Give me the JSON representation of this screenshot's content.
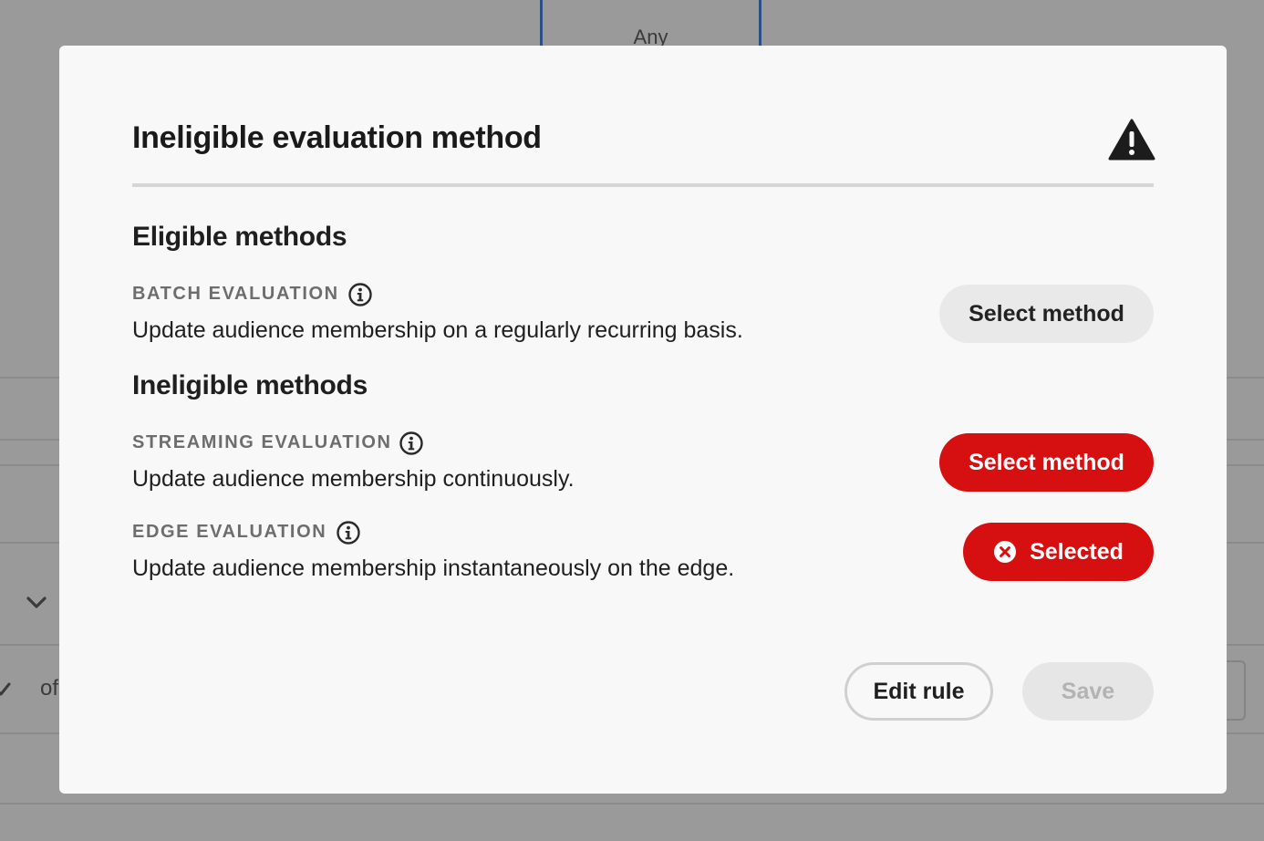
{
  "background": {
    "tab_label": "Any",
    "partial_text": "of"
  },
  "dialog": {
    "title": "Ineligible evaluation method",
    "eligible": {
      "heading": "Eligible methods",
      "methods": [
        {
          "label": "BATCH EVALUATION",
          "description": "Update audience membership on a regularly recurring basis.",
          "button_label": "Select method"
        }
      ]
    },
    "ineligible": {
      "heading": "Ineligible methods",
      "methods": [
        {
          "label": "STREAMING EVALUATION",
          "description": "Update audience membership continuously.",
          "button_label": "Select method"
        },
        {
          "label": "EDGE EVALUATION",
          "description": "Update audience membership instantaneously on the edge.",
          "button_label": "Selected"
        }
      ]
    },
    "footer": {
      "edit_label": "Edit rule",
      "save_label": "Save"
    }
  },
  "colors": {
    "negative": "#d60f11",
    "overlay": "#9a9a9a",
    "dialog_bg": "#f8f8f8",
    "secondary_button": "#e9e9e9",
    "disabled_text": "#b3b3b3"
  },
  "icons": {
    "title": "warning-triangle-icon",
    "method_info": "info-circle-icon",
    "selected": "x-circle-icon",
    "background_dropdown": "chevron-down-icon",
    "background_check": "checkmark-icon"
  }
}
